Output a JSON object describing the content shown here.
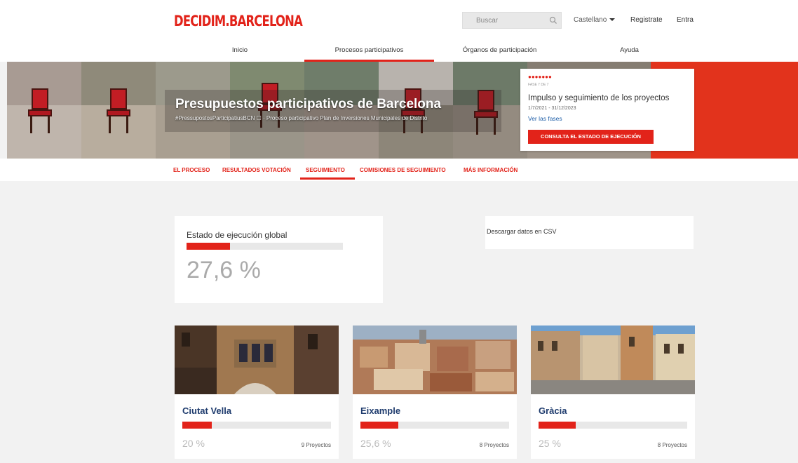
{
  "header": {
    "logo": "DECIDIM.BARCELONA",
    "search_placeholder": "Buscar",
    "language": "Castellano",
    "register": "Registrate",
    "login": "Entra"
  },
  "nav": {
    "items": [
      "Inicio",
      "Procesos participativos",
      "Órganos de participación",
      "Ayuda"
    ],
    "active_index": 1
  },
  "hero": {
    "title": "Presupuestos participativos de Barcelona",
    "subtitle": "#PressupostosParticipatiusBCN ☐   ·   Proceso participativo Plan de Inversiones Municipales de Distrito"
  },
  "phase": {
    "dots": "●●●●●●●",
    "label": "FASE 7 DE 7",
    "title": "Impulso y seguimiento de los proyectos",
    "dates": "1/7/2021 - 31/12/2023",
    "link": "Ver las fases",
    "button": "CONSULTA EL ESTADO DE EJECUCIÓN"
  },
  "tabs": {
    "items": [
      "EL PROCESO",
      "RESULTADOS VOTACIÓN",
      "SEGUIMIENTO",
      "COMISIONES DE SEGUIMIENTO",
      "MÁS INFORMACIÓN"
    ],
    "active_index": 2
  },
  "global": {
    "title": "Estado de ejecución global",
    "percent_label": "27,6 %",
    "progress": 0.276
  },
  "csv": {
    "label": "Descargar datos en CSV"
  },
  "districts": [
    {
      "name": "Ciutat Vella",
      "percent_label": "20 %",
      "progress": 0.2,
      "projects": "9 Proyectos"
    },
    {
      "name": "Eixample",
      "percent_label": "25,6 %",
      "progress": 0.256,
      "projects": "8 Proyectos"
    },
    {
      "name": "Gràcia",
      "percent_label": "25 %",
      "progress": 0.25,
      "projects": "8 Proyectos"
    }
  ],
  "colors": {
    "accent": "#e2231a",
    "link": "#1f5fa8",
    "district_title": "#1f3c6e"
  }
}
